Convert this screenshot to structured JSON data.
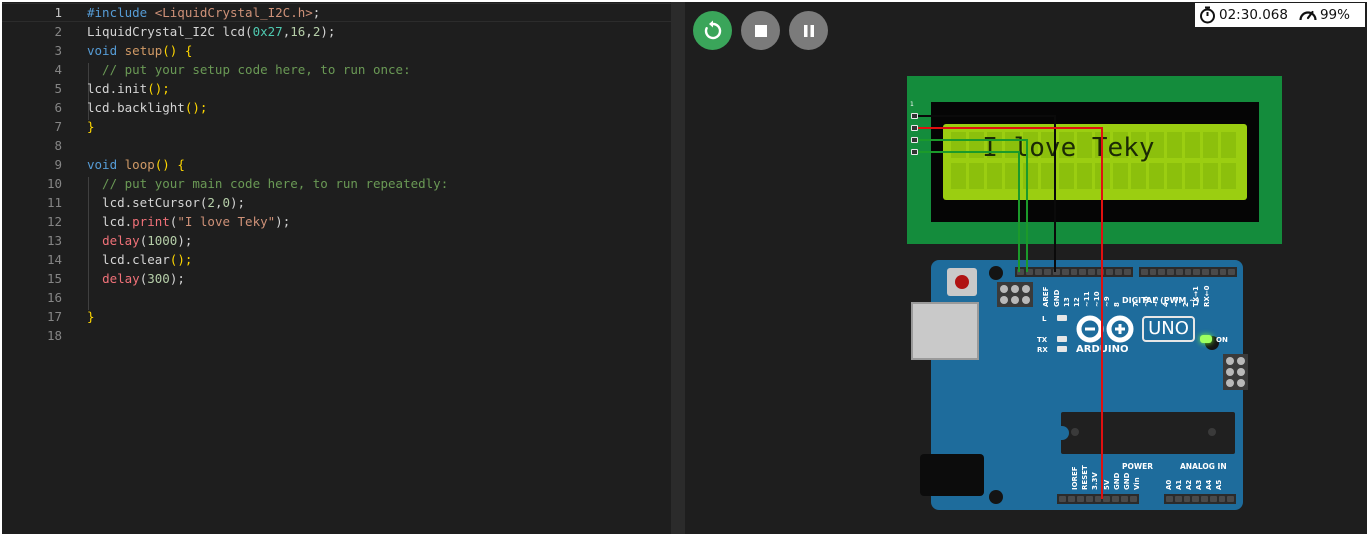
{
  "editor": {
    "lines": [
      {
        "n": "1",
        "parts": [
          {
            "t": "#include ",
            "c": "t-pre"
          },
          {
            "t": "<LiquidCrystal_I2C.h>",
            "c": "t-inc"
          },
          {
            "t": ";",
            "c": ""
          }
        ]
      },
      {
        "n": "2",
        "parts": [
          {
            "t": "LiquidCrystal_I2C lcd(",
            "c": ""
          },
          {
            "t": "0x27",
            "c": "t-hex"
          },
          {
            "t": ",",
            "c": ""
          },
          {
            "t": "16",
            "c": "t-num"
          },
          {
            "t": ",",
            "c": ""
          },
          {
            "t": "2",
            "c": "t-num"
          },
          {
            "t": ");",
            "c": ""
          }
        ]
      },
      {
        "n": "3",
        "parts": [
          {
            "t": "void ",
            "c": "t-kw"
          },
          {
            "t": "setup",
            "c": "t-lf"
          },
          {
            "t": "() {",
            "c": "t-brace"
          }
        ]
      },
      {
        "n": "4",
        "parts": [
          {
            "t": "  // put your setup code here, to run once:",
            "c": "t-com"
          }
        ]
      },
      {
        "n": "5",
        "parts": [
          {
            "t": "lcd.",
            "c": ""
          },
          {
            "t": "init",
            "c": ""
          },
          {
            "t": "();",
            "c": "t-call"
          }
        ]
      },
      {
        "n": "6",
        "parts": [
          {
            "t": "lcd.backlight",
            "c": ""
          },
          {
            "t": "();",
            "c": "t-call"
          }
        ]
      },
      {
        "n": "7",
        "parts": [
          {
            "t": "}",
            "c": "t-brace"
          }
        ]
      },
      {
        "n": "8",
        "parts": []
      },
      {
        "n": "9",
        "parts": [
          {
            "t": "void ",
            "c": "t-kw"
          },
          {
            "t": "loop",
            "c": "t-lf"
          },
          {
            "t": "() {",
            "c": "t-brace"
          }
        ]
      },
      {
        "n": "10",
        "parts": [
          {
            "t": "  // put your main code here, to run repeatedly:",
            "c": "t-com"
          }
        ]
      },
      {
        "n": "11",
        "parts": [
          {
            "t": "  lcd.setCursor(",
            "c": ""
          },
          {
            "t": "2",
            "c": "t-num"
          },
          {
            "t": ",",
            "c": ""
          },
          {
            "t": "0",
            "c": "t-num"
          },
          {
            "t": ");",
            "c": ""
          }
        ]
      },
      {
        "n": "12",
        "parts": [
          {
            "t": "  lcd.",
            "c": ""
          },
          {
            "t": "print",
            "c": "t-red"
          },
          {
            "t": "(",
            "c": ""
          },
          {
            "t": "\"I love Teky\"",
            "c": "t-str"
          },
          {
            "t": ");",
            "c": ""
          }
        ]
      },
      {
        "n": "13",
        "parts": [
          {
            "t": "  ",
            "c": ""
          },
          {
            "t": "delay",
            "c": "t-red"
          },
          {
            "t": "(",
            "c": ""
          },
          {
            "t": "1000",
            "c": "t-num"
          },
          {
            "t": ");",
            "c": ""
          }
        ]
      },
      {
        "n": "14",
        "parts": [
          {
            "t": "  lcd.clear",
            "c": ""
          },
          {
            "t": "();",
            "c": "t-call"
          }
        ]
      },
      {
        "n": "15",
        "parts": [
          {
            "t": "  ",
            "c": ""
          },
          {
            "t": "delay",
            "c": "t-red"
          },
          {
            "t": "(",
            "c": ""
          },
          {
            "t": "300",
            "c": "t-num"
          },
          {
            "t": ");",
            "c": ""
          }
        ]
      },
      {
        "n": "16",
        "parts": []
      },
      {
        "n": "17",
        "parts": [
          {
            "t": "}",
            "c": "t-brace"
          }
        ]
      },
      {
        "n": "18",
        "parts": []
      }
    ]
  },
  "simulator": {
    "controls": {
      "restart": "restart-icon",
      "stop": "stop-icon",
      "pause": "pause-icon"
    },
    "status": {
      "time": "02:30.068",
      "speed": "99%"
    },
    "lcd": {
      "text": "  I love Teky",
      "pin_number": "1"
    },
    "board": {
      "model": "UNO",
      "brand": "ARDUINO",
      "on_label": "ON",
      "l_label": "L",
      "tx_label": "TX",
      "rx_label": "RX",
      "digital_label": "DIGITAL (PWM ~)",
      "power_label": "POWER",
      "analog_label": "ANALOG IN",
      "top_pins": [
        "AREF",
        "GND",
        "13",
        "12",
        "~11",
        "~10",
        "~9",
        "8",
        "7",
        "~6",
        "~5",
        "4",
        "~3",
        "2",
        "TX→1",
        "RX←0"
      ],
      "bottom_pins": [
        "IOREF",
        "RESET",
        "3.3V",
        "5V",
        "GND",
        "GND",
        "Vin",
        "A0",
        "A1",
        "A2",
        "A3",
        "A4",
        "A5"
      ]
    },
    "colors": {
      "accent_green": "#3aa55a",
      "lcd_green": "#9bce11",
      "board_blue": "#1e6c9c",
      "wire_red": "#e01010",
      "wire_green": "#1b9a2a"
    }
  }
}
